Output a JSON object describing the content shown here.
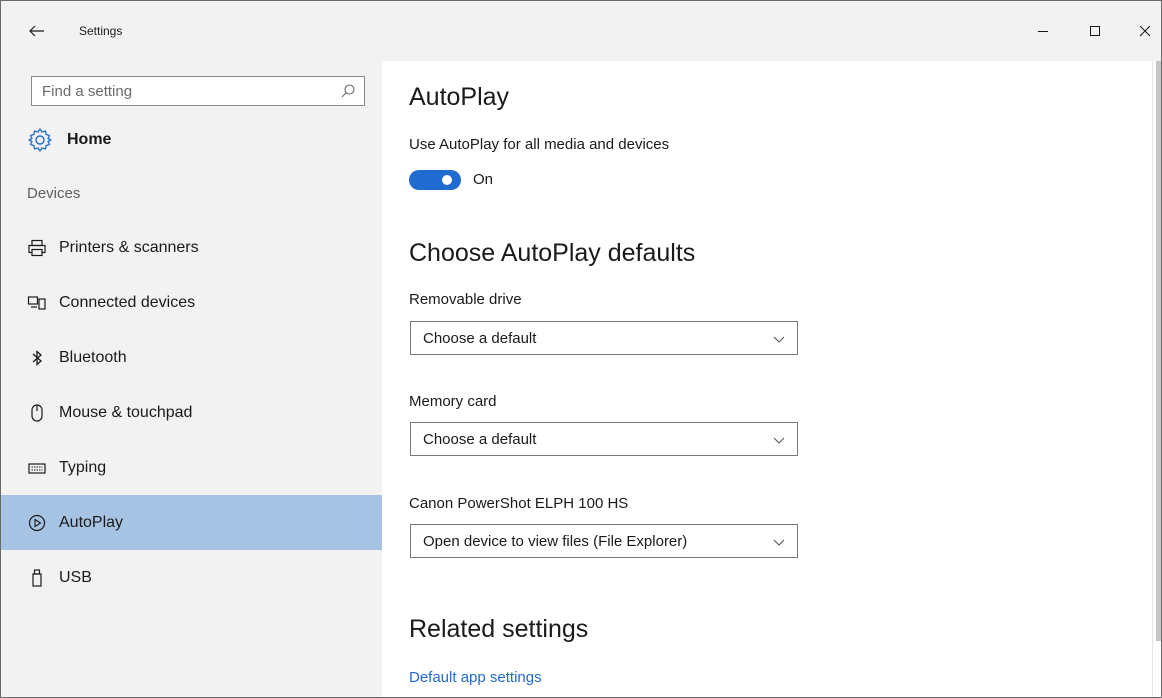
{
  "window": {
    "title": "Settings",
    "back_icon": "arrow-left-icon",
    "controls": [
      "minimize-icon",
      "maximize-icon",
      "close-icon"
    ]
  },
  "sidebar": {
    "search": {
      "placeholder": "Find a setting",
      "value": "",
      "icon": "search-icon"
    },
    "home": {
      "label": "Home",
      "icon": "gear-icon"
    },
    "section_label": "Devices",
    "items": [
      {
        "label": "Printers & scanners",
        "icon": "printer-icon",
        "selected": false
      },
      {
        "label": "Connected devices",
        "icon": "connected-devices-icon",
        "selected": false
      },
      {
        "label": "Bluetooth",
        "icon": "bluetooth-icon",
        "selected": false
      },
      {
        "label": "Mouse & touchpad",
        "icon": "mouse-icon",
        "selected": false
      },
      {
        "label": "Typing",
        "icon": "keyboard-icon",
        "selected": false
      },
      {
        "label": "AutoPlay",
        "icon": "autoplay-icon",
        "selected": true
      },
      {
        "label": "USB",
        "icon": "usb-icon",
        "selected": false
      }
    ],
    "selected_color": "#a7c3e3"
  },
  "main": {
    "title": "AutoPlay",
    "toggle": {
      "label": "Use AutoPlay for all media and devices",
      "state_text": "On",
      "on": true,
      "color": "#1f6bcf"
    },
    "defaults_heading": "Choose AutoPlay defaults",
    "defaults": [
      {
        "label": "Removable drive",
        "value": "Choose a default"
      },
      {
        "label": "Memory card",
        "value": "Choose a default"
      },
      {
        "label": "Canon PowerShot ELPH 100 HS",
        "value": "Open device to view files (File Explorer)"
      }
    ],
    "related_heading": "Related settings",
    "related_link": "Default app settings",
    "link_color": "#1f6bcf"
  }
}
